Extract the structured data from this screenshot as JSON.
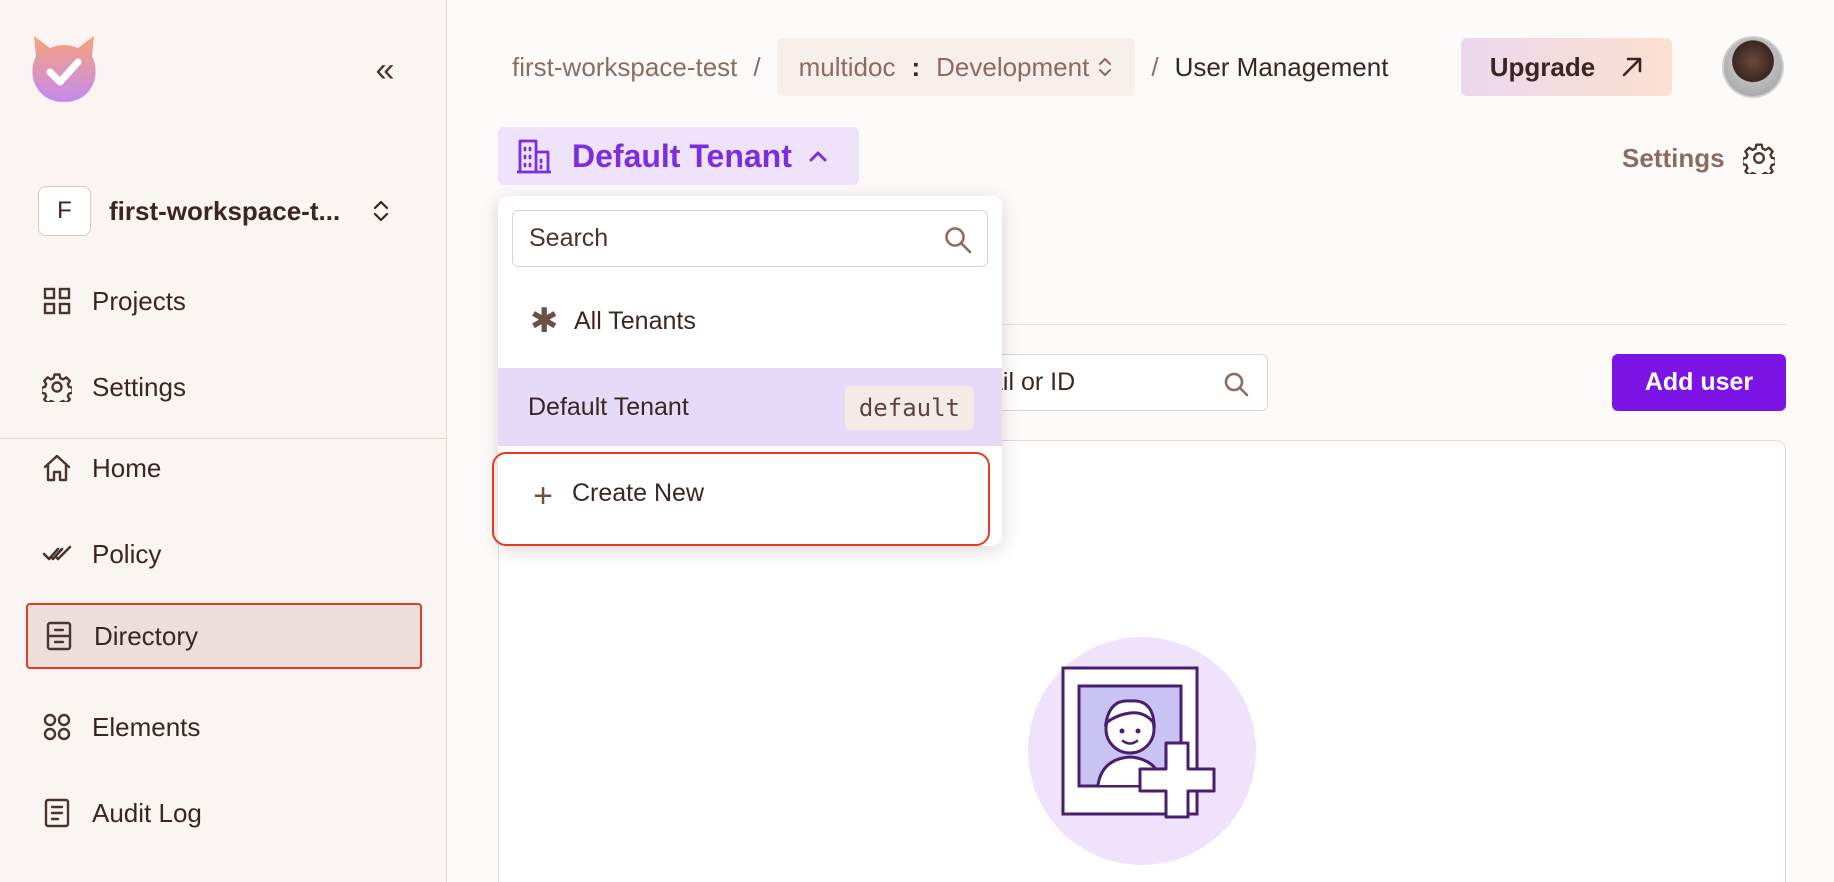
{
  "sidebar": {
    "collapse_glyph": "«",
    "workspace": {
      "initial": "F",
      "name": "first-workspace-t..."
    },
    "items": [
      {
        "label": "Projects",
        "icon": "grid-icon"
      },
      {
        "label": "Settings",
        "icon": "gear-icon"
      },
      {
        "label": "Home",
        "icon": "home-icon"
      },
      {
        "label": "Policy",
        "icon": "double-check-icon"
      },
      {
        "label": "Directory",
        "icon": "directory-icon",
        "active": true
      },
      {
        "label": "Elements",
        "icon": "elements-icon"
      },
      {
        "label": "Audit Log",
        "icon": "audit-log-icon"
      }
    ]
  },
  "header": {
    "breadcrumb": {
      "workspace": "first-workspace-test",
      "separator": "/",
      "project": "multidoc",
      "colon": ":",
      "environment": "Development",
      "current": "User Management"
    },
    "upgrade_label": "Upgrade"
  },
  "tenant_selector": {
    "label": "Default Tenant"
  },
  "settings_label": "Settings",
  "user_search": {
    "visible_text": "ail or ID"
  },
  "add_user_label": "Add user",
  "dropdown": {
    "search_placeholder": "Search",
    "all_star": "✱",
    "all_tenants_label": "All Tenants",
    "selected": {
      "label": "Default Tenant",
      "key": "default"
    },
    "create_plus": "+",
    "create_new_label": "Create New"
  },
  "colors": {
    "accent": "#7b14e4",
    "highlight": "#e03d22",
    "sidebar_bg": "#faf4f2"
  }
}
